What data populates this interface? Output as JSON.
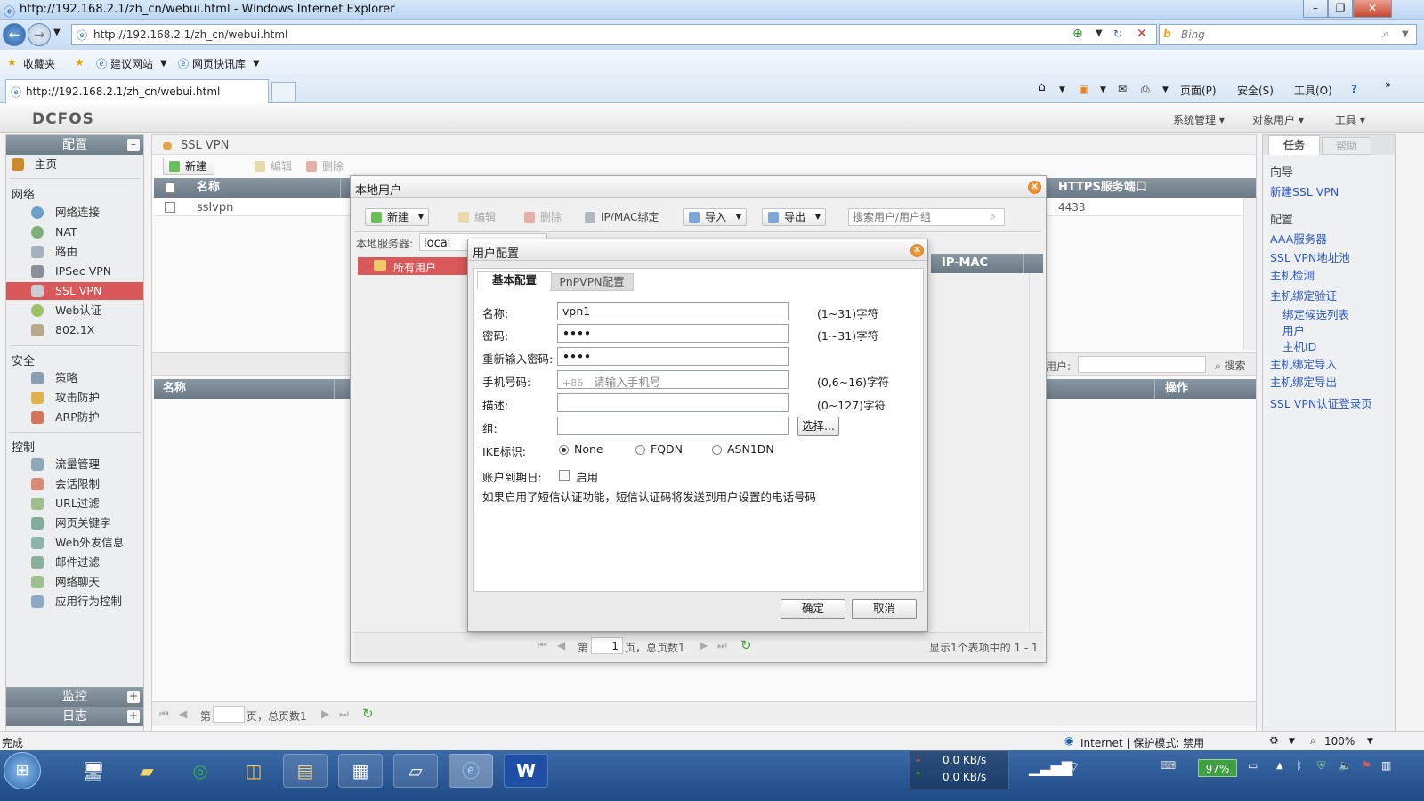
{
  "browser": {
    "window_title": "http://192.168.2.1/zh_cn/webui.html - Windows Internet Explorer",
    "address": "http://192.168.2.1/zh_cn/webui.html",
    "search_placeholder": "Bing",
    "favorites": [
      "收藏夹",
      "建议网站",
      "网页快讯库"
    ],
    "tab_title": "http://192.168.2.1/zh_cn/webui.html",
    "commands": [
      "页面(P)",
      "安全(S)",
      "工具(O)"
    ]
  },
  "app": {
    "logo": "DCFOS",
    "top_menu": [
      "系统管理",
      "对象用户",
      "工具"
    ],
    "left": {
      "config_header": "配置",
      "home": "主页",
      "network_section": "网络",
      "network_items": [
        "网络连接",
        "NAT",
        "路由",
        "IPSec VPN",
        "SSL VPN",
        "Web认证",
        "802.1X"
      ],
      "security_section": "安全",
      "security_items": [
        "策略",
        "攻击防护",
        "ARP防护"
      ],
      "control_section": "控制",
      "control_items": [
        "流量管理",
        "会话限制",
        "URL过滤",
        "网页关键字",
        "Web外发信息",
        "邮件过滤",
        "网络聊天",
        "应用行为控制"
      ],
      "monitor_header": "监控",
      "log_header": "日志"
    },
    "center": {
      "title": "SSL VPN",
      "toolbar": {
        "new": "新建",
        "edit": "编辑",
        "delete": "删除"
      },
      "grid": {
        "col_name": "名称",
        "col_https": "HTTPS服务端口",
        "row_name": "sslvpn",
        "row_port": "4433"
      },
      "lower_grid": {
        "col_name": "名称",
        "col_op": "操作",
        "user_label": "用户:",
        "search": "搜索"
      },
      "pager": {
        "prefix": "第",
        "suffix": "页，总页数1"
      }
    },
    "right": {
      "tab_tasks": "任务",
      "tab_help": "帮助",
      "wizard_section": "向导",
      "wizard_link": "新建SSL VPN",
      "config_section": "配置",
      "links": [
        {
          "label": "AAA服务器",
          "sub": false
        },
        {
          "label": "SSL VPN地址池",
          "sub": false
        },
        {
          "label": "主机检测",
          "sub": false
        },
        {
          "label": "主机绑定验证",
          "sub": false
        },
        {
          "label": "绑定候选列表",
          "sub": true
        },
        {
          "label": "用户",
          "sub": true
        },
        {
          "label": "主机ID",
          "sub": true
        },
        {
          "label": "主机绑定导入",
          "sub": false
        },
        {
          "label": "主机绑定导出",
          "sub": false
        },
        {
          "label": "SSL VPN认证登录页",
          "sub": false
        }
      ]
    }
  },
  "local_user_dialog": {
    "title": "本地用户",
    "toolbar": {
      "new": "新建",
      "edit": "编辑",
      "delete": "删除",
      "ipmac": "IP/MAC绑定",
      "import": "导入",
      "export": "导出"
    },
    "search_placeholder": "搜索用户/用户组",
    "server_label": "本地服务器:",
    "server_value": "local",
    "tree_all_users": "所有用户",
    "col_ipmac": "IP-MAC",
    "pager_prefix": "第",
    "pager_page": "1",
    "pager_suffix": "页，总页数1",
    "pager_info": "显示1个表项中的 1 - 1"
  },
  "user_config_dialog": {
    "title": "用户配置",
    "tab_basic": "基本配置",
    "tab_pnpvpn": "PnPVPN配置",
    "fields": {
      "name_label": "名称:",
      "name_value": "vpn1",
      "name_hint": "(1~31)字符",
      "password_label": "密码:",
      "password_value": "••••",
      "password_hint": "(1~31)字符",
      "repassword_label": "重新输入密码:",
      "repassword_value": "••••",
      "phone_label": "手机号码:",
      "phone_prefix": "+86",
      "phone_placeholder": "请输入手机号",
      "phone_hint": "(0,6~16)字符",
      "desc_label": "描述:",
      "desc_hint": "(0~127)字符",
      "group_label": "组:",
      "select_button": "选择...",
      "ike_label": "IKE标识:",
      "ike_options": [
        "None",
        "FQDN",
        "ASN1DN"
      ],
      "expire_label": "账户到期日:",
      "expire_enable": "启用",
      "note": "如果启用了短信认证功能，短信认证码将发送到用户设置的电话号码"
    },
    "ok": "确定",
    "cancel": "取消"
  },
  "statusbar": {
    "left": "完成",
    "zone": "Internet | 保护模式: 禁用",
    "zoom": "100%"
  },
  "taskbar": {
    "down_speed": "0.0 KB/s",
    "up_speed": "0.0 KB/s",
    "battery": "97%"
  }
}
